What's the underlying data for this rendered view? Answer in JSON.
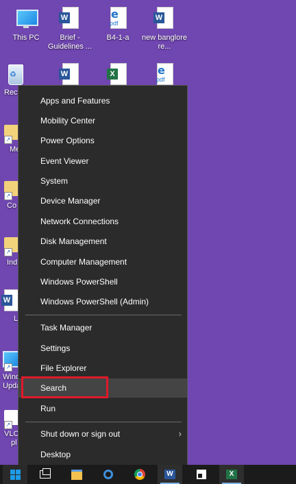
{
  "desktop": {
    "icons": [
      {
        "label": "This PC"
      },
      {
        "label": "Brief - Guidelines ..."
      },
      {
        "label": "B4-1-a"
      },
      {
        "label": "new banglore re..."
      }
    ],
    "partials": [
      "Recy",
      "Me",
      "Co",
      "Ind",
      "L",
      "Wind",
      "Upda",
      "VLC",
      "pl"
    ],
    "second_row_icon_names": [
      "word-document-icon",
      "excel-document-icon",
      "pdf-document-icon"
    ]
  },
  "context_menu": {
    "items": [
      "Apps and Features",
      "Mobility Center",
      "Power Options",
      "Event Viewer",
      "System",
      "Device Manager",
      "Network Connections",
      "Disk Management",
      "Computer Management",
      "Windows PowerShell",
      "Windows PowerShell (Admin)",
      "Task Manager",
      "Settings",
      "File Explorer",
      "Search",
      "Run",
      "Shut down or sign out",
      "Desktop"
    ],
    "submenu_indicator": "›",
    "highlighted_item": "Search",
    "highlight_color": "#e0192a"
  },
  "taskbar": {
    "icons": [
      "windows-start-icon",
      "task-view-icon",
      "file-explorer-icon",
      "internet-explorer-icon",
      "chrome-icon",
      "word-icon",
      "sticky-notes-icon",
      "excel-icon"
    ]
  },
  "colors": {
    "desktop_background": "#7046b1",
    "menu_background": "#2b2b2b",
    "taskbar_background": "#1b1b1b"
  }
}
